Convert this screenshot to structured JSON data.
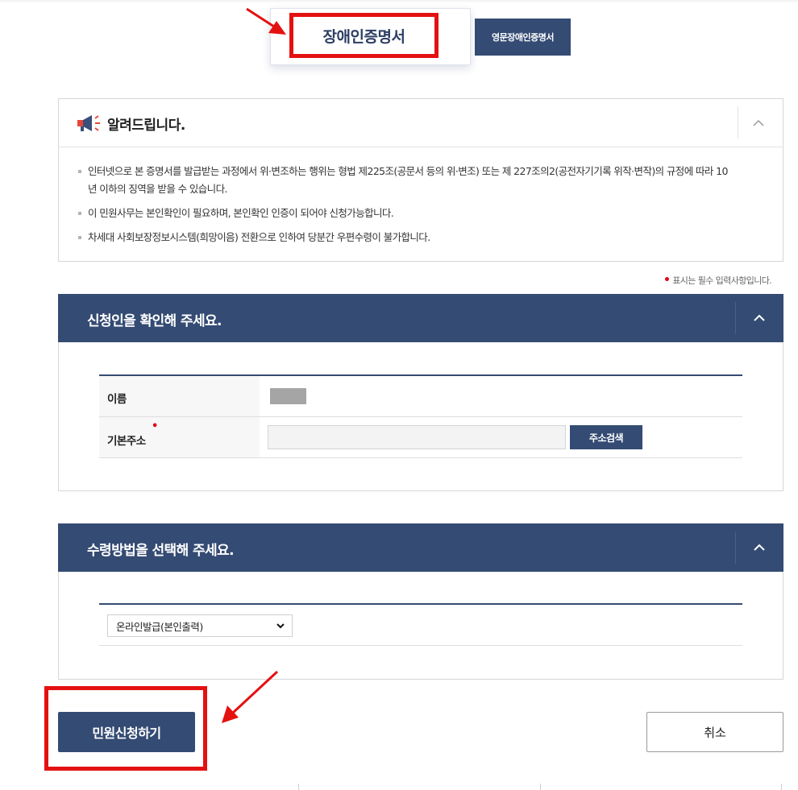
{
  "tabs": {
    "primary_label": "장애인증명서",
    "secondary_label": "영문장애인증명서"
  },
  "notice": {
    "title": "알려드립니다.",
    "items": [
      "인터넷으로 본 증명서를 발급받는 과정에서 위·변조하는 행위는 형법 제225조(공문서 등의 위·변조) 또는 제 227조의2(공전자기기록 위작·변작)의 규정에 따라 10",
      "년 이하의 징역을 받을 수 있습니다.",
      "이 민원사무는 본인확인이 필요하며, 본인확인 인증이 되어야 신청가능합니다.",
      "차세대 사회보장정보시스템(희망이음) 전환으로 인하여 당분간 우편수령이 불가합니다."
    ],
    "toggle_icon": "chevron-up-icon"
  },
  "required_note": "표시는 필수 입력사항입니다.",
  "applicant_section": {
    "title": "신청인을 확인해 주세요.",
    "name_label": "이름",
    "address_label": "기본주소",
    "address_value": "",
    "address_search_label": "주소검색"
  },
  "receipt_section": {
    "title": "수령방법을 선택해 주세요.",
    "selected_method": "온라인발급(본인출력)"
  },
  "actions": {
    "submit_label": "민원신청하기",
    "cancel_label": "취소"
  },
  "colors": {
    "navy": "#344b73",
    "highlight_red": "#e41111",
    "required_red": "#e3001b"
  }
}
